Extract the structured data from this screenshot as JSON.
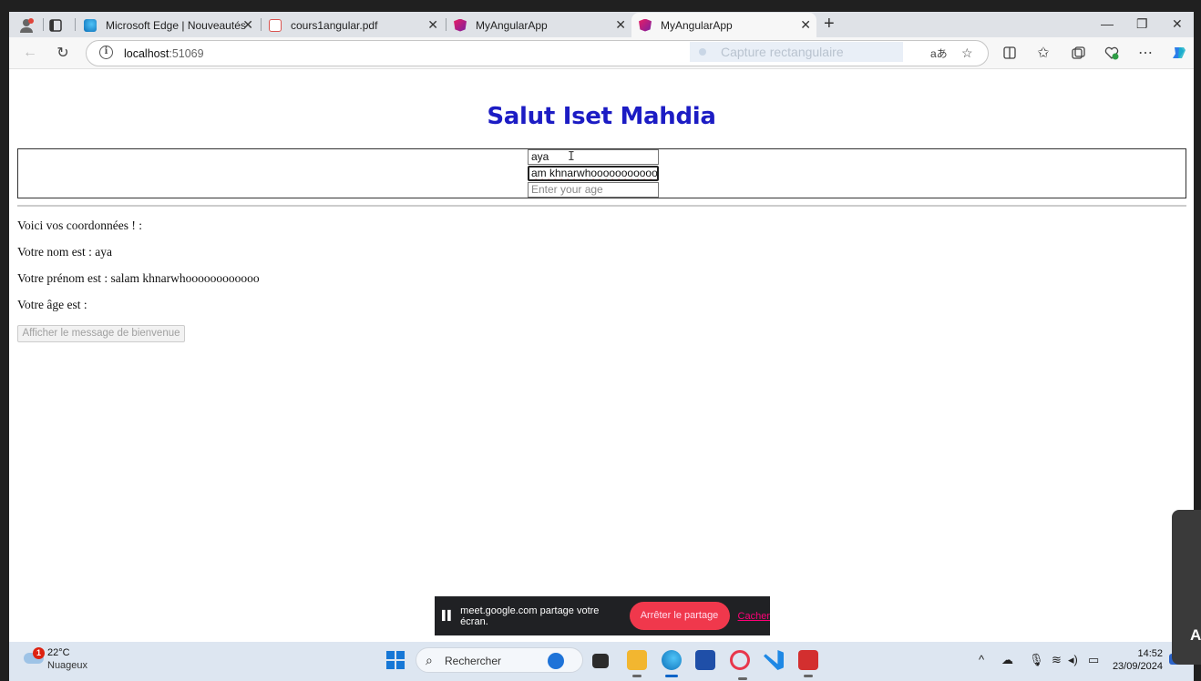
{
  "browser": {
    "tabs": [
      {
        "title": "Microsoft Edge | Nouveautés",
        "active": false,
        "icon": "edge-icon"
      },
      {
        "title": "cours1angular.pdf",
        "active": false,
        "icon": "pdf-icon"
      },
      {
        "title": "MyAngularApp",
        "active": false,
        "icon": "angular-icon"
      },
      {
        "title": "MyAngularApp",
        "active": true,
        "icon": "angular-icon"
      }
    ],
    "address": {
      "host": "localhost",
      "port": ":51069"
    },
    "overlay_capture": "Capture rectangulaire"
  },
  "page": {
    "title": "Salut Iset Mahdia",
    "title_color": "#1c1cc4",
    "inputs": {
      "nom_value": "aya",
      "prenom_value": "am khnarwhoooooooooooo",
      "age_placeholder": "Enter your age"
    },
    "lines": {
      "intro": "Voici vos coordonnées ! :",
      "nom": "Votre nom est : aya",
      "prenom": "Votre prénom est : salam khnarwhoooooooooooo",
      "age": "Votre âge est :"
    },
    "button_label": "Afficher le message de bienvenue"
  },
  "share_banner": {
    "text": "meet.google.com partage votre écran.",
    "stop_label": "Arrêter le partage",
    "hide_label": "Cacher"
  },
  "taskbar": {
    "weather_badge": "1",
    "temperature": "22°C",
    "condition": "Nuageux",
    "search_placeholder": "Rechercher",
    "time": "14:52",
    "date": "23/09/2024"
  },
  "side_panel_letter": "A"
}
